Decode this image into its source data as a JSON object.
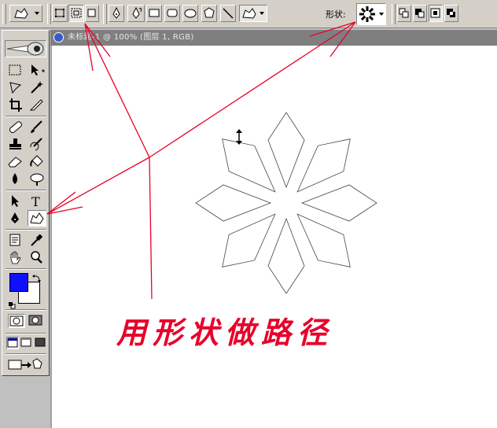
{
  "options_bar": {
    "shape_label": "形状:",
    "shape_preset_icon": "flower-shape-icon",
    "tools": [
      "shape-layers-icon",
      "paths-icon",
      "fill-pixels-icon",
      "pen-icon",
      "freeform-pen-icon",
      "rectangle-icon",
      "rounded-rectangle-icon",
      "ellipse-icon",
      "polygon-icon",
      "line-icon",
      "custom-shape-icon"
    ]
  },
  "document": {
    "title": "未标题-1 @ 100% (图层 1, RGB)"
  },
  "toolbox": {
    "foreground_color": "#1010ff",
    "background_color": "#ffffff"
  },
  "annotation": {
    "caption": "用形状做路径",
    "color": "#e8002a"
  }
}
